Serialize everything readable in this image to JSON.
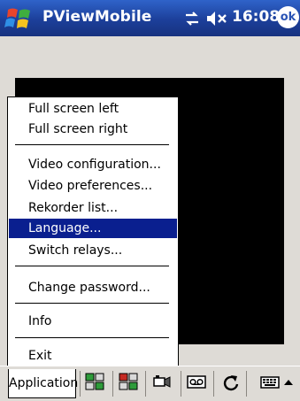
{
  "titlebar": {
    "app_title": "PViewMobile",
    "clock": "16:08",
    "ok_label": "ok"
  },
  "menu": {
    "items": [
      {
        "label": "Full screen left"
      },
      {
        "label": "Full screen right"
      },
      {
        "label": "Video configuration..."
      },
      {
        "label": "Video preferences..."
      },
      {
        "label": "Rekorder list..."
      },
      {
        "label": "Language..."
      },
      {
        "label": "Switch relays..."
      },
      {
        "label": "Change password..."
      },
      {
        "label": "Info"
      },
      {
        "label": "Exit"
      }
    ],
    "selected": "Language..."
  },
  "menubar": {
    "application_label": "Application"
  },
  "colors": {
    "titlebar": "#1c3f9a",
    "selection": "#0a1f8f",
    "background": "#dedbd6"
  }
}
